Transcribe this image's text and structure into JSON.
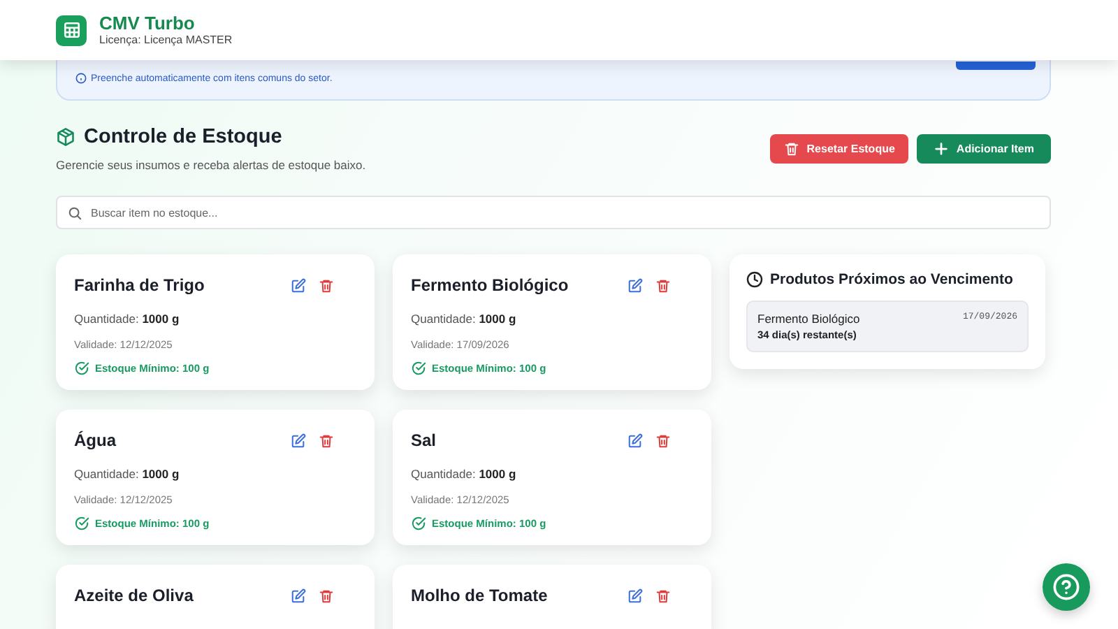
{
  "header": {
    "title": "CMV Turbo",
    "license": "Licença: Licença MASTER"
  },
  "autofill_panel": {
    "hint": "Preenche automaticamente com itens comuns do setor."
  },
  "section": {
    "title": "Controle de Estoque",
    "subtitle": "Gerencie seus insumos e receba alertas de estoque baixo.",
    "buttons": [
      {
        "kind": "danger",
        "label": "Resetar Estoque"
      },
      {
        "kind": "primary",
        "label": "Adicionar Item"
      }
    ]
  },
  "search": {
    "placeholder": "Buscar item no estoque..."
  },
  "items": [
    {
      "name": "Farinha de Trigo",
      "quantity": "Quantidade: **1000 g**",
      "validity": "Validade: 12/12/2025",
      "minimum": "Estoque Mínimo: 100 g"
    },
    {
      "name": "Fermento Biológico",
      "quantity": "Quantidade: **1000 g**",
      "validity": "Validade: 17/09/2026",
      "minimum": "Estoque Mínimo: 100 g"
    },
    {
      "name": "Água",
      "quantity": "Quantidade: **1000 g**",
      "validity": "Validade: 12/12/2025",
      "minimum": "Estoque Mínimo: 100 g"
    },
    {
      "name": "Sal",
      "quantity": "Quantidade: **1000 g**",
      "validity": "Validade: 12/12/2025",
      "minimum": "Estoque Mínimo: 100 g"
    },
    {
      "name": "Azeite de Oliva"
    },
    {
      "name": "Molho de Tomate"
    }
  ],
  "expiring": {
    "title": "Produtos Próximos ao Vencimento",
    "items": [
      {
        "name": "Fermento Biológico",
        "date": "17/09/2026",
        "remaining": "34 dia(s) restante(s)"
      }
    ]
  }
}
